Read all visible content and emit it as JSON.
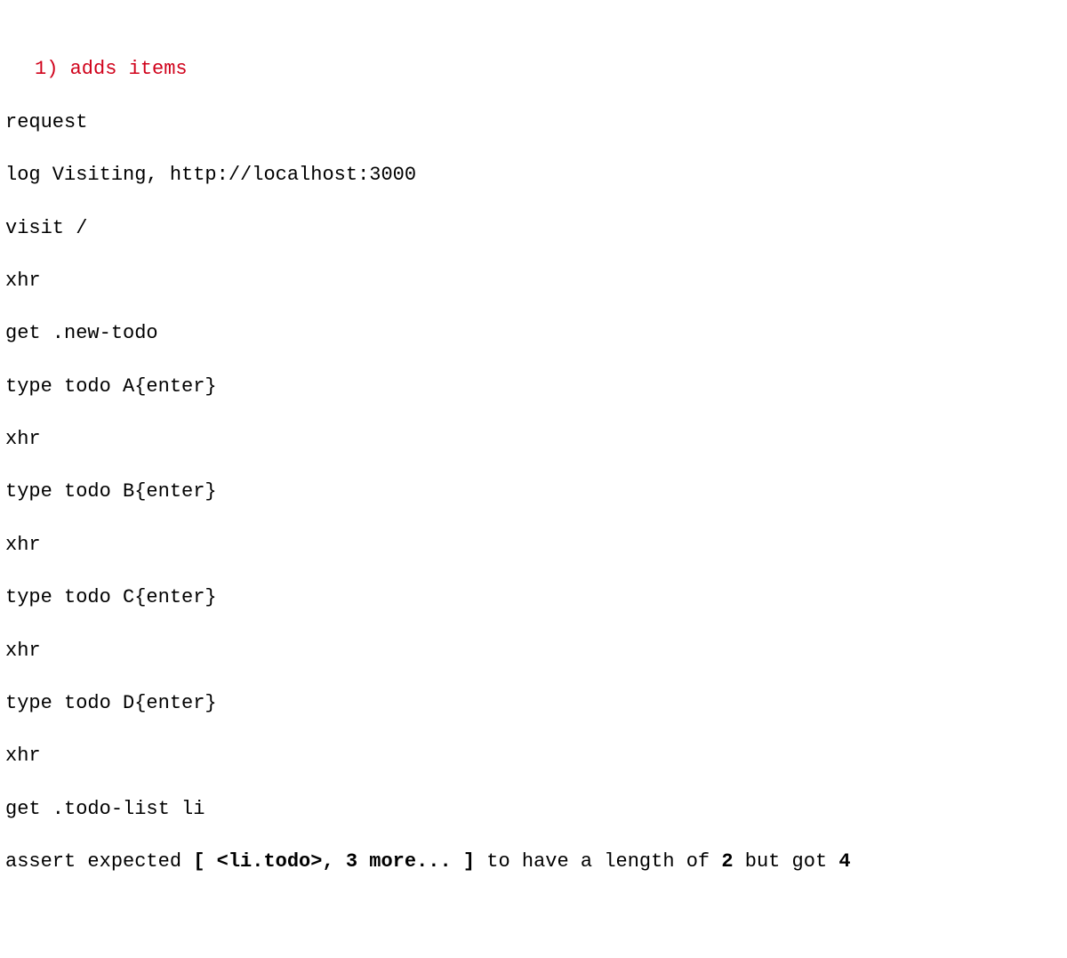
{
  "test": {
    "index": "1)",
    "name": "adds items"
  },
  "lines": {
    "l1": "request",
    "l2": "log Visiting, http://localhost:3000",
    "l3": "visit /",
    "l4": "xhr",
    "l5": "get .new-todo",
    "l6": "type todo A{enter}",
    "l7": "xhr",
    "l8": "type todo B{enter}",
    "l9": "xhr",
    "l10": "type todo C{enter}",
    "l11": "xhr",
    "l12": "type todo D{enter}",
    "l13": "xhr",
    "l14": "get .todo-list li"
  },
  "assert": {
    "prefix": "assert expected ",
    "bracket_open": "[ ",
    "element": "<li.todo>, 3 more...",
    "bracket_close": " ]",
    "middle": " to have a length of ",
    "expected": "2",
    "connector": " but got ",
    "actual": "4"
  }
}
